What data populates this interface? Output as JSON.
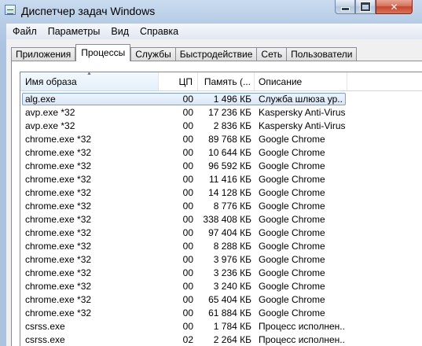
{
  "window": {
    "title": "Диспетчер задач Windows"
  },
  "title_buttons": {
    "minimize": "",
    "maximize": "",
    "close": "✕"
  },
  "menu": [
    "Файл",
    "Параметры",
    "Вид",
    "Справка"
  ],
  "tabs": [
    "Приложения",
    "Процессы",
    "Службы",
    "Быстродействие",
    "Сеть",
    "Пользователи"
  ],
  "active_tab": "Процессы",
  "columns": {
    "name": "Имя образа",
    "cpu": "ЦП",
    "memory": "Память (...",
    "description": "Описание"
  },
  "sort_indicator": "▲",
  "processes": [
    {
      "name": "alg.exe",
      "cpu": "00",
      "memory": "1 496 КБ",
      "description": "Служба шлюза ур...",
      "selected": true
    },
    {
      "name": "avp.exe *32",
      "cpu": "00",
      "memory": "17 236 КБ",
      "description": "Kaspersky Anti-Virus"
    },
    {
      "name": "avp.exe *32",
      "cpu": "00",
      "memory": "2 836 КБ",
      "description": "Kaspersky Anti-Virus"
    },
    {
      "name": "chrome.exe *32",
      "cpu": "00",
      "memory": "89 768 КБ",
      "description": "Google Chrome"
    },
    {
      "name": "chrome.exe *32",
      "cpu": "00",
      "memory": "10 644 КБ",
      "description": "Google Chrome"
    },
    {
      "name": "chrome.exe *32",
      "cpu": "00",
      "memory": "96 592 КБ",
      "description": "Google Chrome"
    },
    {
      "name": "chrome.exe *32",
      "cpu": "00",
      "memory": "11 416 КБ",
      "description": "Google Chrome"
    },
    {
      "name": "chrome.exe *32",
      "cpu": "00",
      "memory": "14 128 КБ",
      "description": "Google Chrome"
    },
    {
      "name": "chrome.exe *32",
      "cpu": "00",
      "memory": "8 776 КБ",
      "description": "Google Chrome"
    },
    {
      "name": "chrome.exe *32",
      "cpu": "00",
      "memory": "338 408 КБ",
      "description": "Google Chrome"
    },
    {
      "name": "chrome.exe *32",
      "cpu": "00",
      "memory": "97 404 КБ",
      "description": "Google Chrome"
    },
    {
      "name": "chrome.exe *32",
      "cpu": "00",
      "memory": "8 288 КБ",
      "description": "Google Chrome"
    },
    {
      "name": "chrome.exe *32",
      "cpu": "00",
      "memory": "3 976 КБ",
      "description": "Google Chrome"
    },
    {
      "name": "chrome.exe *32",
      "cpu": "00",
      "memory": "3 236 КБ",
      "description": "Google Chrome"
    },
    {
      "name": "chrome.exe *32",
      "cpu": "00",
      "memory": "3 240 КБ",
      "description": "Google Chrome"
    },
    {
      "name": "chrome.exe *32",
      "cpu": "00",
      "memory": "65 404 КБ",
      "description": "Google Chrome"
    },
    {
      "name": "chrome.exe *32",
      "cpu": "00",
      "memory": "61 884 КБ",
      "description": "Google Chrome"
    },
    {
      "name": "csrss.exe",
      "cpu": "00",
      "memory": "1 784 КБ",
      "description": "Процесс исполнен..."
    },
    {
      "name": "csrss.exe",
      "cpu": "02",
      "memory": "2 264 КБ",
      "description": "Процесс исполнен..."
    }
  ]
}
